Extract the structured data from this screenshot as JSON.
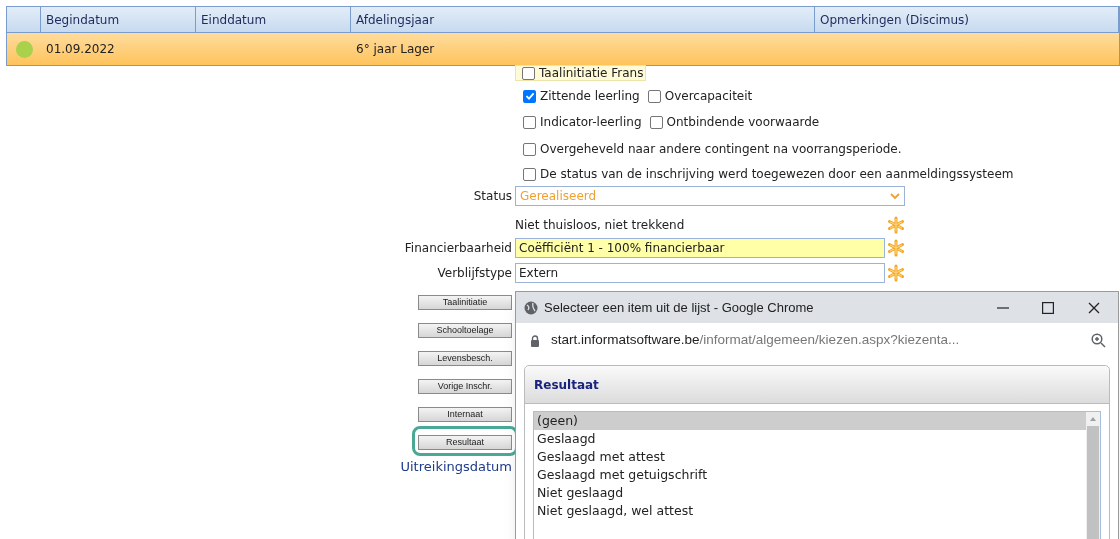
{
  "table": {
    "columns": [
      "Begindatum",
      "Einddatum",
      "Afdelingsjaar",
      "Opmerkingen (Discimus)"
    ],
    "rows": [
      {
        "selected": true,
        "color": "#a9d14b",
        "begindatum": "01.09.2022",
        "afdelingsjaar": "6° jaar Lager"
      }
    ]
  },
  "partial_checkbox": {
    "label": "Taalinitiatie Frans",
    "checked": false
  },
  "checkbox_rows": [
    [
      {
        "label": "Zittende leerling",
        "checked": true
      },
      {
        "label": "Overcapaciteit",
        "checked": false
      }
    ],
    [
      {
        "label": "Indicator-leerling",
        "checked": false
      },
      {
        "label": "Ontbindende voorwaarde",
        "checked": false
      }
    ],
    [
      {
        "label": "Overgeheveld naar andere contingent na voorrangsperiode.",
        "checked": false
      }
    ],
    [
      {
        "label": "De status van de inschrijving werd toegewezen door een aanmeldingssysteem",
        "checked": false
      }
    ]
  ],
  "fields": [
    {
      "kind": "select",
      "label": "Status",
      "value": "Gerealiseerd",
      "required": false
    },
    {
      "kind": "text",
      "value": "Niet thuisloos, niet trekkend",
      "required": true
    },
    {
      "kind": "input",
      "label": "Financierbaarheid",
      "value": "Coëfficiënt 1 - 100% financierbaar",
      "highlighted": true,
      "required": true
    },
    {
      "kind": "input",
      "label": "Verblijfstype",
      "value": "Extern",
      "highlighted": false,
      "required": true
    }
  ],
  "side_buttons": [
    {
      "label": "Taalinitiatie",
      "focused": false
    },
    {
      "label": "Schooltoelage",
      "focused": false
    },
    {
      "label": "Levensbesch.",
      "focused": false
    },
    {
      "label": "Vorige Inschr.",
      "focused": false
    },
    {
      "label": "Internaat",
      "focused": false
    },
    {
      "label": "Resultaat",
      "focused": true
    }
  ],
  "uitreikingsdatum_label": "Uitreikingsdatum",
  "popup": {
    "title": "Selecteer een item uit de lijst - Google Chrome",
    "url_host": "start.informatsoftware.be",
    "url_path": "/informat/algemeen/kiezen.aspx?kiezenta...",
    "panel_title": "Resultaat",
    "items": [
      {
        "label": "(geen)",
        "selected": true
      },
      {
        "label": "Geslaagd",
        "selected": false
      },
      {
        "label": "Geslaagd met attest",
        "selected": false
      },
      {
        "label": "Geslaagd met getuigschrift",
        "selected": false
      },
      {
        "label": "Niet geslaagd",
        "selected": false
      },
      {
        "label": "Niet geslaagd, wel attest",
        "selected": false
      }
    ]
  }
}
